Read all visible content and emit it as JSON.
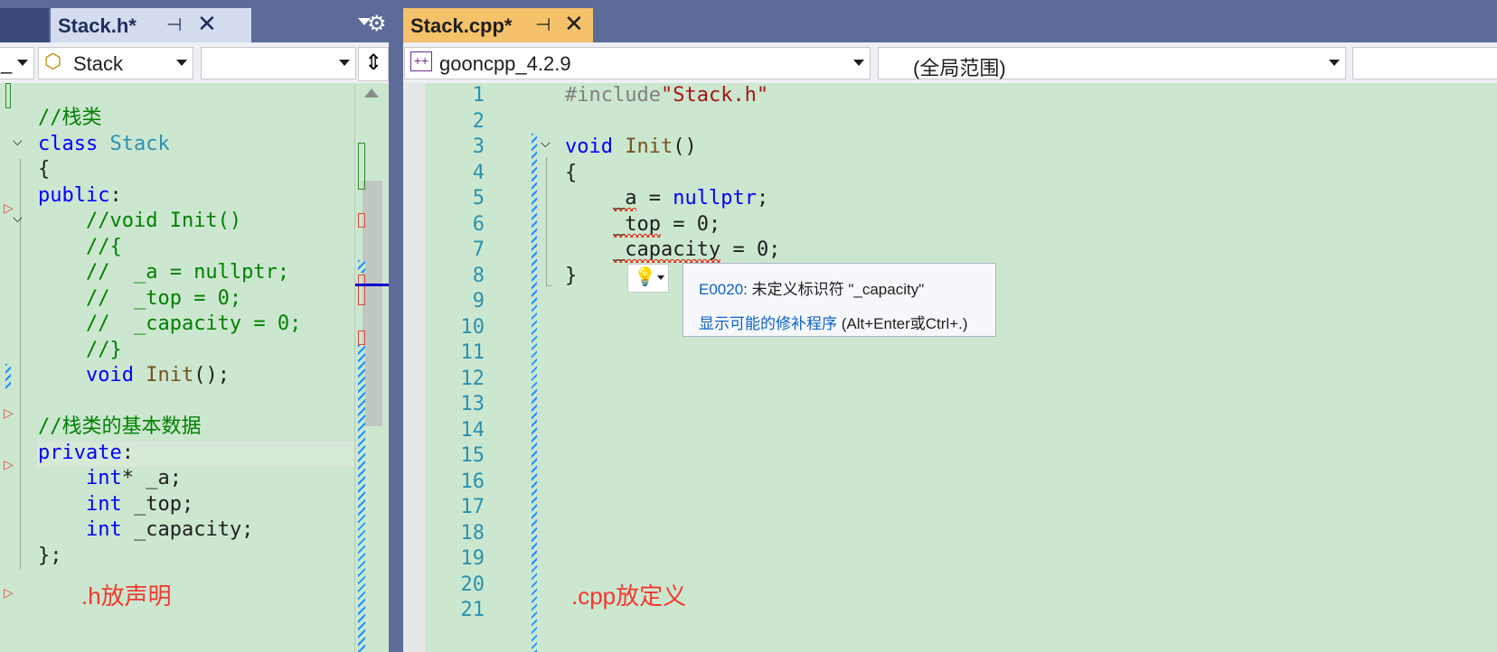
{
  "left_pane": {
    "tab": {
      "title": "Stack.h*"
    },
    "nav": {
      "scope": "Stack",
      "member": "",
      "first": "_"
    },
    "code": [
      {
        "segs": [
          [
            "cm",
            "//栈类"
          ]
        ]
      },
      {
        "segs": [
          [
            "kw",
            "class"
          ],
          [
            "tx",
            " "
          ],
          [
            "ty",
            "Stack"
          ]
        ]
      },
      {
        "segs": [
          [
            "tx",
            "{"
          ]
        ]
      },
      {
        "segs": [
          [
            "kw",
            "public"
          ],
          [
            "tx",
            ":"
          ]
        ]
      },
      {
        "segs": [
          [
            "tx",
            "    "
          ],
          [
            "cm",
            "//void Init()"
          ]
        ]
      },
      {
        "segs": [
          [
            "tx",
            "    "
          ],
          [
            "cm",
            "//{"
          ]
        ]
      },
      {
        "segs": [
          [
            "tx",
            "    "
          ],
          [
            "cm",
            "//  _a = nullptr;"
          ]
        ]
      },
      {
        "segs": [
          [
            "tx",
            "    "
          ],
          [
            "cm",
            "//  _top = 0;"
          ]
        ]
      },
      {
        "segs": [
          [
            "tx",
            "    "
          ],
          [
            "cm",
            "//  _capacity = 0;"
          ]
        ]
      },
      {
        "segs": [
          [
            "tx",
            "    "
          ],
          [
            "cm",
            "//}"
          ]
        ]
      },
      {
        "segs": [
          [
            "tx",
            "    "
          ],
          [
            "kw",
            "void"
          ],
          [
            "tx",
            " "
          ],
          [
            "fn",
            "Init"
          ],
          [
            "tx",
            "();"
          ]
        ]
      },
      {
        "segs": [
          [
            "tx",
            ""
          ]
        ]
      },
      {
        "segs": [
          [
            "cm",
            "//栈类的基本数据"
          ]
        ]
      },
      {
        "segs": [
          [
            "kw",
            "private"
          ],
          [
            "tx",
            ":"
          ]
        ]
      },
      {
        "segs": [
          [
            "tx",
            "    "
          ],
          [
            "kw",
            "int"
          ],
          [
            "tx",
            "* _a;"
          ]
        ]
      },
      {
        "segs": [
          [
            "tx",
            "    "
          ],
          [
            "kw",
            "int"
          ],
          [
            "tx",
            " _top;"
          ]
        ]
      },
      {
        "segs": [
          [
            "tx",
            "    "
          ],
          [
            "kw",
            "int"
          ],
          [
            "tx",
            " _capacity;"
          ]
        ]
      },
      {
        "segs": [
          [
            "tx",
            "};"
          ]
        ]
      }
    ],
    "annotation": ".h放声明"
  },
  "right_pane": {
    "tab": {
      "title": "Stack.cpp*"
    },
    "nav": {
      "project": "gooncpp_4.2.9",
      "scope": "(全局范围)"
    },
    "line_numbers": [
      "1",
      "2",
      "3",
      "4",
      "5",
      "6",
      "7",
      "8",
      "9",
      "10",
      "11",
      "12",
      "13",
      "14",
      "15",
      "16",
      "17",
      "18",
      "19",
      "20",
      "21"
    ],
    "code": [
      {
        "segs": [
          [
            "pp",
            "#include"
          ],
          [
            "st",
            "\"Stack.h\""
          ]
        ]
      },
      {
        "segs": [
          [
            "tx",
            ""
          ]
        ]
      },
      {
        "segs": [
          [
            "kw",
            "void"
          ],
          [
            "tx",
            " "
          ],
          [
            "fn",
            "Init"
          ],
          [
            "tx",
            "()"
          ]
        ]
      },
      {
        "segs": [
          [
            "tx",
            "{"
          ]
        ]
      },
      {
        "segs": [
          [
            "tx",
            "    "
          ],
          [
            "sq",
            "_a"
          ],
          [
            "tx",
            " = "
          ],
          [
            "kw",
            "nullptr"
          ],
          [
            "tx",
            ";"
          ]
        ]
      },
      {
        "segs": [
          [
            "tx",
            "    "
          ],
          [
            "sq",
            "_top"
          ],
          [
            "tx",
            " = 0;"
          ]
        ]
      },
      {
        "segs": [
          [
            "tx",
            "    "
          ],
          [
            "sq",
            "_capacity"
          ],
          [
            "tx",
            " = 0;"
          ]
        ]
      },
      {
        "segs": [
          [
            "tx",
            "}"
          ]
        ]
      }
    ],
    "annotation": ".cpp放定义"
  },
  "tooltip": {
    "error_code": "E0020",
    "message": ": 未定义标识符 \"_capacity\"",
    "fix_link": "显示可能的修补程序",
    "shortcut": " (Alt+Enter或Ctrl+.)"
  },
  "colors": {
    "editor_bg": "#cce7cf",
    "tab_bar": "#5d6b98",
    "active_tab": "#f5c26b",
    "keyword": "#0000ff",
    "type": "#2b91af",
    "comment": "#008000"
  }
}
